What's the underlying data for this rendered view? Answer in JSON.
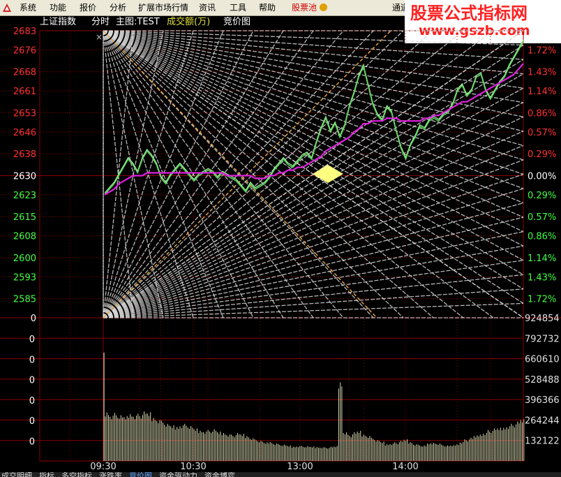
{
  "menu": {
    "items": [
      "系统",
      "功能",
      "报价",
      "分析",
      "扩展市场行情",
      "资讯",
      "工具",
      "帮助"
    ],
    "pool_label": "股票池",
    "channel_label": "通道"
  },
  "watermark": {
    "title": "股票公式指标网",
    "url": "www.gszb.com"
  },
  "header": {
    "index_name": "上证指数",
    "mode": "分时",
    "main_chart": "主图:TEST",
    "volume_label": "成交额(万)",
    "auction_label": "竞价图"
  },
  "colors": {
    "up": "#ff3030",
    "down": "#40ff40",
    "price": "#60d060",
    "average": "#e020e0",
    "grid": "#8b0000",
    "fan": "#d8d8d8",
    "background": "#000000"
  },
  "chart_data": {
    "type": "line",
    "title": "上证指数 分时",
    "prev_close": 2630,
    "ylim": [
      2578,
      2683
    ],
    "price_ticks_left": [
      2683,
      2676,
      2668,
      2661,
      2653,
      2646,
      2638,
      2630,
      2623,
      2615,
      2608,
      2600,
      2593,
      2585
    ],
    "percent_ticks_right": [
      "1.72%",
      "1.43%",
      "1.14%",
      "0.86%",
      "0.57%",
      "0.29%",
      "0.00%",
      "0.29%",
      "0.57%",
      "0.86%",
      "1.14%",
      "1.43%",
      "1.72%"
    ],
    "time_ticks": [
      "09:30",
      "10:30",
      "13:00",
      "14:00"
    ],
    "volume_ticks_right": [
      924854,
      792732,
      660610,
      528488,
      396366,
      264244,
      132122
    ],
    "volume_ticks_left": [
      0,
      0,
      0,
      0,
      0,
      0,
      0,
      0
    ],
    "series": [
      {
        "name": "price",
        "values": [
          2623,
          2625,
          2627,
          2630,
          2633,
          2636,
          2634,
          2631,
          2636,
          2639,
          2637,
          2634,
          2629,
          2627,
          2630,
          2632,
          2634,
          2632,
          2630,
          2628,
          2630,
          2631,
          2632,
          2631,
          2629,
          2631,
          2630,
          2629,
          2628,
          2626,
          2624,
          2627,
          2625,
          2626,
          2627,
          2629,
          2632,
          2634,
          2636,
          2634,
          2633,
          2635,
          2637,
          2638,
          2636,
          2642,
          2647,
          2651,
          2646,
          2649,
          2644,
          2648,
          2655,
          2660,
          2666,
          2670,
          2663,
          2656,
          2652,
          2650,
          2655,
          2653,
          2646,
          2640,
          2636,
          2641,
          2644,
          2648,
          2647,
          2650,
          2651,
          2650,
          2652,
          2653,
          2656,
          2661,
          2663,
          2659,
          2661,
          2666,
          2667,
          2661,
          2658,
          2661,
          2664,
          2666,
          2670,
          2673,
          2676,
          2679
        ]
      },
      {
        "name": "average",
        "values": [
          2623,
          2624,
          2625,
          2627,
          2628,
          2629,
          2630,
          2630,
          2630,
          2631,
          2631,
          2631,
          2631,
          2631,
          2631,
          2631,
          2631,
          2631,
          2631,
          2631,
          2631,
          2631,
          2631,
          2631,
          2631,
          2631,
          2630,
          2630,
          2630,
          2630,
          2630,
          2630,
          2629,
          2629,
          2629,
          2630,
          2630,
          2631,
          2631,
          2632,
          2632,
          2633,
          2633,
          2634,
          2635,
          2636,
          2637,
          2639,
          2640,
          2641,
          2642,
          2643,
          2644,
          2646,
          2647,
          2649,
          2649,
          2650,
          2650,
          2650,
          2651,
          2651,
          2651,
          2650,
          2650,
          2650,
          2650,
          2650,
          2651,
          2651,
          2652,
          2652,
          2653,
          2654,
          2655,
          2656,
          2657,
          2657,
          2658,
          2659,
          2660,
          2661,
          2662,
          2663,
          2664,
          2665,
          2666,
          2667,
          2669,
          2671
        ]
      }
    ],
    "volume_values": [
      320000,
      300000,
      310000,
      295000,
      290000,
      310000,
      300000,
      305000,
      320000,
      315000,
      285000,
      270000,
      260000,
      240000,
      230000,
      225000,
      235000,
      240000,
      225000,
      210000,
      200000,
      195000,
      200000,
      205000,
      190000,
      185000,
      175000,
      170000,
      180000,
      175000,
      165000,
      150000,
      140000,
      130000,
      120000,
      125000,
      115000,
      110000,
      105000,
      100000,
      95000,
      98000,
      97000,
      95000,
      94000,
      92000,
      90000,
      88000,
      92000,
      96000,
      520000,
      190000,
      170000,
      185000,
      195000,
      175000,
      165000,
      150000,
      135000,
      125000,
      110000,
      115000,
      120000,
      130000,
      140000,
      125000,
      110000,
      105000,
      100000,
      115000,
      120000,
      115000,
      105000,
      100000,
      102000,
      110000,
      125000,
      140000,
      150000,
      165000,
      175000,
      185000,
      200000,
      210000,
      215000,
      220000,
      230000,
      240000,
      255000,
      270000
    ]
  },
  "bottom_tabs": [
    "成交明细",
    "指标",
    "多空指标",
    "涨跌率",
    "竞价图",
    "资金驱动力",
    "资金博弈"
  ]
}
